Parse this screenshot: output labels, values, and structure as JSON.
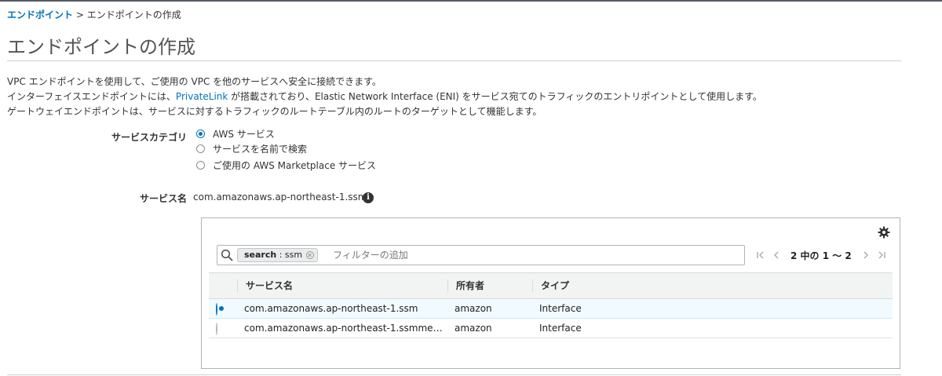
{
  "breadcrumb": {
    "link": "エンドポイント",
    "separator": " > ",
    "current": "エンドポイントの作成"
  },
  "page_title": "エンドポイントの作成",
  "description": {
    "line1": "VPC エンドポイントを使用して、ご使用の VPC を他のサービスへ安全に接続できます。",
    "line2_before": "インターフェイスエンドポイントには、",
    "line2_link": "PrivateLink",
    "line2_after": " が搭載されており、Elastic Network Interface (ENI) をサービス宛てのトラフィックのエントリポイントとして使用します。",
    "line3": "ゲートウェイエンドポイントは、サービスに対するトラフィックのルートテーブル内のルートのターゲットとして機能します。"
  },
  "service_category": {
    "label": "サービスカテゴリ",
    "options": [
      {
        "label": "AWS サービス",
        "selected": true
      },
      {
        "label": "サービスを名前で検索",
        "selected": false
      },
      {
        "label": "ご使用の AWS Marketplace サービス",
        "selected": false
      }
    ]
  },
  "service_name": {
    "label": "サービス名",
    "value": "com.amazonaws.ap-northeast-1.ssm",
    "icon": "info-icon"
  },
  "table": {
    "settings_icon": "gear-icon",
    "search": {
      "icon": "search-icon",
      "token_key": "search",
      "token_sep": " : ",
      "token_value": "ssm",
      "placeholder": "フィルターの追加",
      "value": ""
    },
    "pagination": {
      "text": "2 中の 1 ～ 2"
    },
    "columns": [
      "サービス名",
      "所有者",
      "タイプ"
    ],
    "rows": [
      {
        "selected": true,
        "service": "com.amazonaws.ap-northeast-1.ssm",
        "owner": "amazon",
        "type": "Interface"
      },
      {
        "selected": false,
        "service": "com.amazonaws.ap-northeast-1.ssmmess…",
        "owner": "amazon",
        "type": "Interface"
      }
    ]
  },
  "colors": {
    "link": "#0073bb",
    "selected_row": "#f1faff",
    "header_bg": "#f2f3f3"
  }
}
